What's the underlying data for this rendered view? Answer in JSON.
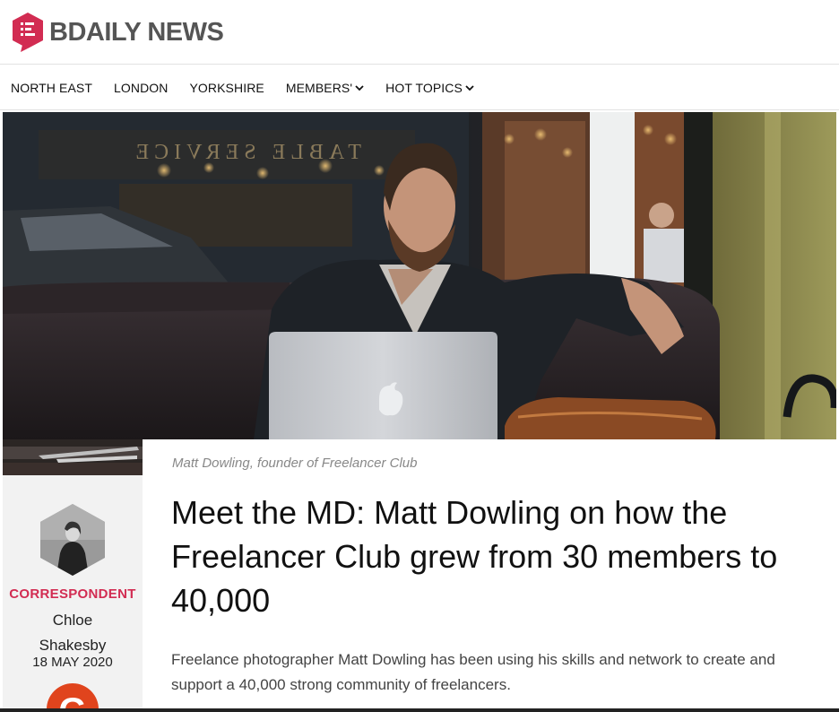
{
  "brand": {
    "name_bold": "BDAILY NEWS",
    "accent": "#d22c52"
  },
  "nav": {
    "items": [
      {
        "label": "NORTH EAST",
        "dropdown": false
      },
      {
        "label": "LONDON",
        "dropdown": false
      },
      {
        "label": "YORKSHIRE",
        "dropdown": false
      },
      {
        "label": "MEMBERS'",
        "dropdown": true
      },
      {
        "label": "HOT TOPICS",
        "dropdown": true
      }
    ]
  },
  "hero": {
    "sign_text": "TABLE SERVICE",
    "caption": "Matt Dowling, founder of Freelancer Club"
  },
  "author": {
    "role": "CORRESPONDENT",
    "name_first": "Chloe",
    "name_last": "Shakesby",
    "date": "18 MAY 2020",
    "badge_letter": "G",
    "badge_color": "#e0441d"
  },
  "article": {
    "title": "Meet the MD: Matt Dowling on how the Freelancer Club grew from 30 members to 40,000",
    "standfirst": "Freelance photographer Matt Dowling has been using his skills and network to create and support a 40,000 strong community of freelancers."
  }
}
